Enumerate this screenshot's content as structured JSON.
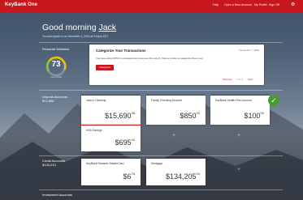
{
  "app": {
    "brand": "KeyBank One"
  },
  "nav": {
    "item1": "Help",
    "item2": "Open a New Account",
    "item3": "My Profile",
    "item4": "Sign Off"
  },
  "header": {
    "greeting": "Good morning",
    "name": "Jack",
    "subtitle": "You last signed in on November 4, 2015 at 9:14pm EST"
  },
  "wellness": {
    "label": "Financial Wellness",
    "score": "73",
    "sub": "out of 100"
  },
  "categorize": {
    "title": "Categorize Your Transactions",
    "date": "November 7, 2015",
    "message": "You have about $750 in uncategorized expenses this month. Take a minute to categorize them now.",
    "button": "Categorize",
    "prev": "Previous",
    "pager": "1 of 3",
    "next": "Next"
  },
  "deposit": {
    "label": "Deposit Accounts",
    "total": "$72,808",
    "accounts": [
      {
        "name": "Jack's Checking",
        "amount": "$15,690",
        "cents": "38"
      },
      {
        "name": "Family Checking Account",
        "amount": "$850",
        "cents": "00"
      },
      {
        "name": "KeyBank Health Plus Account",
        "amount": "$100",
        "cents": "00"
      },
      {
        "name": "HSA Savings",
        "amount": "$695",
        "cents": "40"
      }
    ]
  },
  "credit": {
    "label": "Credit Accounts",
    "total": "$134,213",
    "accounts": [
      {
        "name": "KeyBank Rewards MasterCard",
        "amount": "$6",
        "cents": "78"
      },
      {
        "name": "Mortgage",
        "amount": "$134,205",
        "cents": "00"
      }
    ]
  },
  "investment": {
    "label": "Investment Accounts"
  },
  "colors": {
    "brand_red": "#c8161d",
    "check_green": "#4a9a34"
  }
}
